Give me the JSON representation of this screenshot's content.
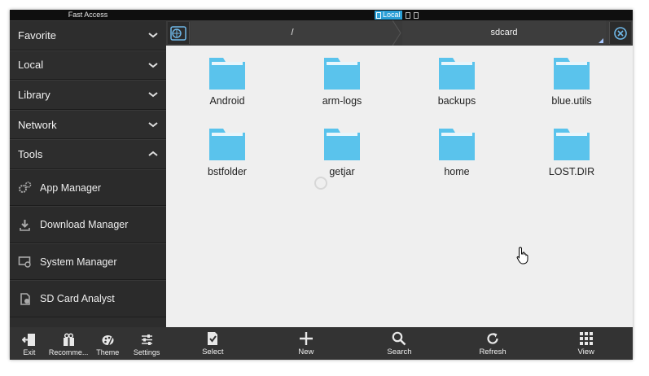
{
  "titlebar": {
    "app_title": "Fast Access",
    "location_badge": "Local"
  },
  "sidebar": {
    "categories": [
      {
        "label": "Favorite",
        "state": "collapsed"
      },
      {
        "label": "Local",
        "state": "collapsed"
      },
      {
        "label": "Library",
        "state": "collapsed"
      },
      {
        "label": "Network",
        "state": "collapsed"
      },
      {
        "label": "Tools",
        "state": "expanded"
      }
    ],
    "tools": [
      {
        "label": "App Manager",
        "icon": "gears-icon"
      },
      {
        "label": "Download Manager",
        "icon": "download-icon"
      },
      {
        "label": "System Manager",
        "icon": "system-icon"
      },
      {
        "label": "SD Card Analyst",
        "icon": "sdcard-icon"
      }
    ],
    "bottom": [
      {
        "label": "Exit",
        "icon": "exit-icon"
      },
      {
        "label": "Recomme...",
        "icon": "gift-icon"
      },
      {
        "label": "Theme",
        "icon": "palette-icon"
      },
      {
        "label": "Settings",
        "icon": "sliders-icon"
      }
    ]
  },
  "pathbar": {
    "crumbs": [
      "/",
      "sdcard"
    ]
  },
  "folders": [
    "Android",
    "arm-logs",
    "backups",
    "blue.utils",
    "bstfolder",
    "getjar",
    "home",
    "LOST.DIR"
  ],
  "toolbar": [
    {
      "label": "Select",
      "icon": "select-icon"
    },
    {
      "label": "New",
      "icon": "plus-icon"
    },
    {
      "label": "Search",
      "icon": "search-icon"
    },
    {
      "label": "Refresh",
      "icon": "refresh-icon"
    },
    {
      "label": "View",
      "icon": "grid-icon"
    }
  ],
  "colors": {
    "accent": "#2b9fd6",
    "folder": "#5ac3ec",
    "panel": "#2d2d2d",
    "content_bg": "#efefef"
  }
}
